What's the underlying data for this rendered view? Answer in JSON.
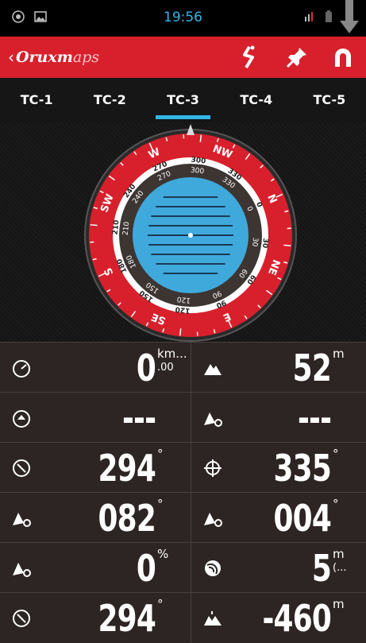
{
  "status_bar": {
    "time": "19:56",
    "icons": [
      "location-icon",
      "image-icon",
      "signal-icon",
      "battery-icon"
    ]
  },
  "action_bar": {
    "back_chevron": "‹",
    "logo_bold": "Oruxm",
    "logo_light": "aps",
    "actions": [
      "route-icon",
      "pin-icon",
      "magnet-icon"
    ],
    "color": "#d8202c"
  },
  "tabs": [
    {
      "label": "TC-1",
      "active": false
    },
    {
      "label": "TC-2",
      "active": false
    },
    {
      "label": "TC-3",
      "active": true
    },
    {
      "label": "TC-4",
      "active": false
    },
    {
      "label": "TC-5",
      "active": false
    }
  ],
  "compass": {
    "outer_labels": [
      "NW",
      "N",
      "NE",
      "E",
      "SE",
      "S",
      "SW",
      "W"
    ],
    "degree_labels": [
      "300",
      "330",
      "0",
      "30",
      "60",
      "90",
      "120",
      "150",
      "180",
      "210",
      "240",
      "270"
    ],
    "inner_labels": [
      "0",
      "30",
      "60",
      "90",
      "120",
      "150",
      "180",
      "210",
      "240",
      "270",
      "300",
      "330"
    ],
    "heading": 294,
    "ring_color": "#d8202c",
    "water_color": "#3fa9dc"
  },
  "data_rows": [
    {
      "left": {
        "icon": "speedometer-icon",
        "value": "0",
        "unit_top": "km...",
        "unit_bottom": ".00"
      },
      "right": {
        "icon": "mountain-icon",
        "value": "52",
        "unit_top": "m",
        "unit_bottom": ""
      }
    },
    {
      "left": {
        "icon": "speed-up-icon",
        "value": "---",
        "unit_top": "",
        "unit_bottom": ""
      },
      "right": {
        "icon": "mountain-target-icon",
        "value": "---",
        "unit_top": "",
        "unit_bottom": ""
      }
    },
    {
      "left": {
        "icon": "compass-icon",
        "value": "294",
        "unit_top": "°",
        "unit_bottom": ""
      },
      "right": {
        "icon": "crosshair-icon",
        "value": "335",
        "unit_top": "°",
        "unit_bottom": ""
      }
    },
    {
      "left": {
        "icon": "mountain-target-icon",
        "value": "082",
        "unit_top": "°",
        "unit_bottom": ""
      },
      "right": {
        "icon": "mountain-target-icon",
        "value": "004",
        "unit_top": "°",
        "unit_bottom": ""
      }
    },
    {
      "left": {
        "icon": "mountain-target-icon",
        "value": "0",
        "unit_top": "%",
        "unit_bottom": ""
      },
      "right": {
        "icon": "gps-accuracy-icon",
        "value": "5",
        "unit_top": "m",
        "unit_bottom": "(..."
      }
    },
    {
      "left": {
        "icon": "compass-icon",
        "value": "294",
        "unit_top": "°",
        "unit_bottom": ""
      },
      "right": {
        "icon": "elevation-diff-icon",
        "value": "-460",
        "unit_top": "m",
        "unit_bottom": ""
      }
    }
  ]
}
